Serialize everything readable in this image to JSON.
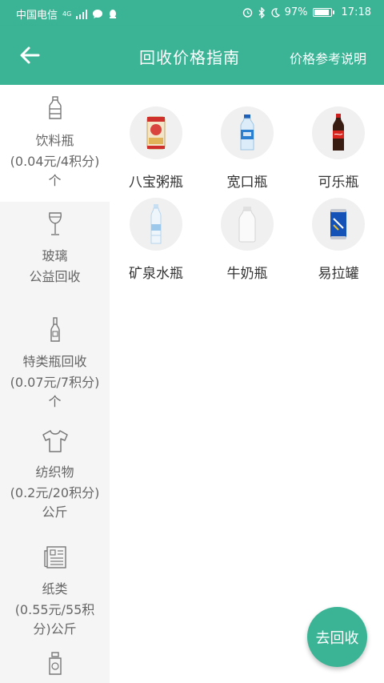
{
  "status_bar": {
    "carrier": "中国电信",
    "network": "4G",
    "battery": "97%",
    "time": "17:18"
  },
  "app_bar": {
    "title": "回收价格指南",
    "action": "价格参考说明"
  },
  "sidebar": {
    "items": [
      {
        "name": "饮料瓶",
        "price": "(0.04元/4积分)个",
        "icon": "bottle-icon",
        "active": true
      },
      {
        "name": "玻璃",
        "price": "公益回收",
        "icon": "wine-glass-icon",
        "active": false
      },
      {
        "name": "特类瓶回收",
        "price": "(0.07元/7积分)个",
        "icon": "wine-bottle-icon",
        "active": false
      },
      {
        "name": "纺织物",
        "price": "(0.2元/20积分)公斤",
        "icon": "tshirt-icon",
        "active": false
      },
      {
        "name": "纸类",
        "price": "(0.55元/55积分)公斤",
        "icon": "newspaper-icon",
        "active": false
      }
    ]
  },
  "items": [
    {
      "label": "八宝粥瓶",
      "icon": "porridge-can-icon"
    },
    {
      "label": "宽口瓶",
      "icon": "wide-mouth-bottle-icon"
    },
    {
      "label": "可乐瓶",
      "icon": "cola-bottle-icon"
    },
    {
      "label": "矿泉水瓶",
      "icon": "water-bottle-icon"
    },
    {
      "label": "牛奶瓶",
      "icon": "milk-bottle-icon"
    },
    {
      "label": "易拉罐",
      "icon": "soda-can-icon"
    }
  ],
  "fab_label": "去回收",
  "colors": {
    "primary": "#3ab495",
    "sidebar_bg": "#f5f5f5",
    "circle_bg": "#f0f0f0"
  }
}
